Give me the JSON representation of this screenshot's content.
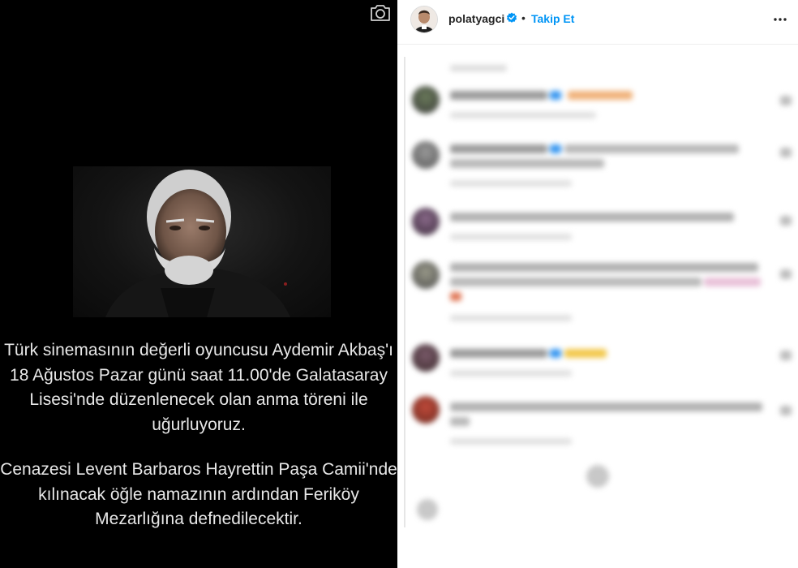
{
  "post": {
    "caption_paragraph_1": "Türk sinemasının değerli oyuncusu Aydemir Akbaş'ı 18 Ağustos Pazar günü saat 11.00'de Galatasaray Lisesi'nde düzenlenecek olan anma töreni ile uğurluyoruz.",
    "caption_paragraph_2": "Cenazesi Levent Barbaros Hayrettin Paşa Camii'nde kılınacak öğle namazının ardından Feriköy Mezarlığına defnedilecektir."
  },
  "header": {
    "username": "polatyagci",
    "separator": "•",
    "follow_label": "Takip Et"
  },
  "colors": {
    "accent": "#0095f6",
    "photo_background": "#000000"
  },
  "icons": [
    "camera-icon",
    "verified-badge-icon",
    "more-options-icon"
  ]
}
